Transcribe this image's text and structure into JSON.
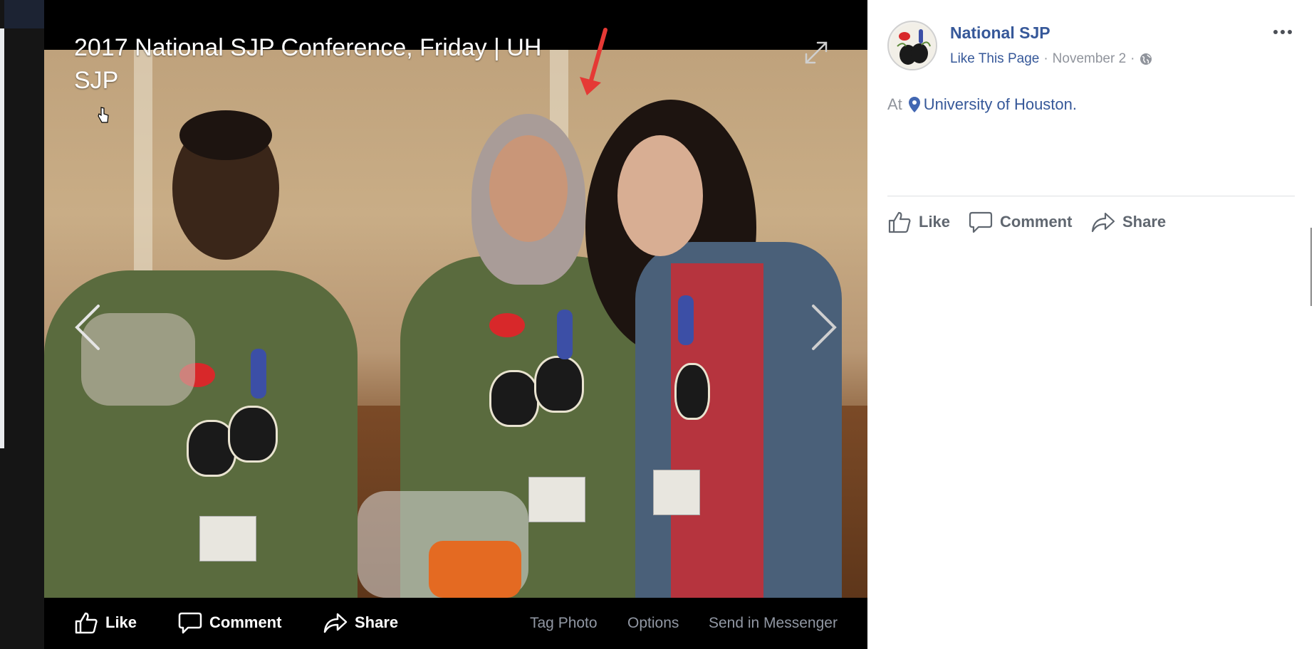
{
  "viewer": {
    "title": "2017 National SJP Conference, Friday | UH SJP",
    "actions": {
      "like": "Like",
      "comment": "Comment",
      "share": "Share",
      "tag_photo": "Tag Photo",
      "options": "Options",
      "send_in_messenger": "Send in Messenger"
    },
    "icons": {
      "expand": "expand-icon",
      "previous": "chevron-left-icon",
      "next": "chevron-right-icon",
      "annotation": "red-arrow-annotation",
      "cursor": "hand-cursor-icon"
    }
  },
  "panel": {
    "page_name": "National SJP",
    "like_page": "Like This Page",
    "dot": "·",
    "date": "November 2",
    "privacy_icon": "globe-icon",
    "location_prefix": "At",
    "location": "University of Houston.",
    "actions": {
      "like": "Like",
      "comment": "Comment",
      "share": "Share"
    }
  },
  "colors": {
    "link_blue": "#365899",
    "meta_gray": "#90949c",
    "annotation_red": "#e53935"
  }
}
